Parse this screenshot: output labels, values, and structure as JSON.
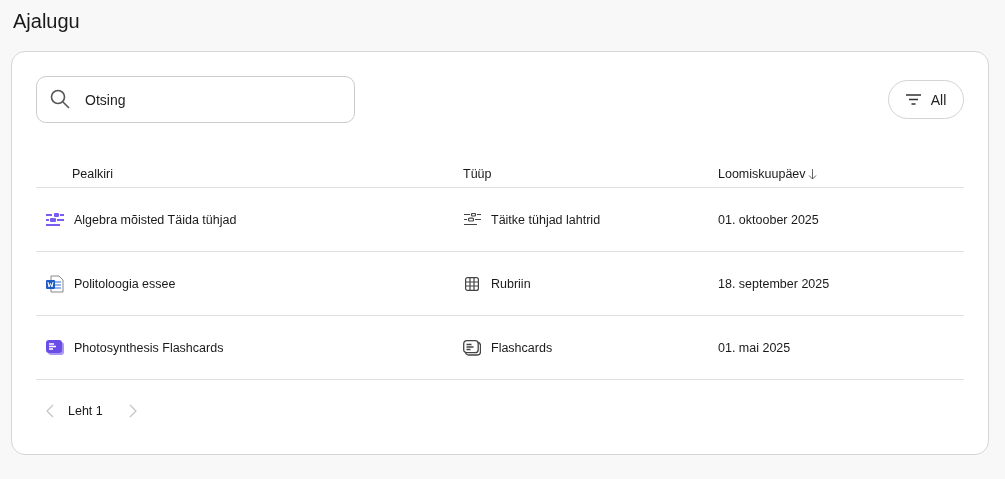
{
  "page": {
    "title": "Ajalugu"
  },
  "search": {
    "placeholder": "Otsing"
  },
  "filter": {
    "label": "All"
  },
  "table": {
    "columns": [
      {
        "label": "Pealkiri",
        "sorted": false
      },
      {
        "label": "Tüüp",
        "sorted": false
      },
      {
        "label": "Loomiskuupäev",
        "sorted": true
      }
    ],
    "rows": [
      {
        "kind": "fill_blanks",
        "title": "Algebra mõisted Täida tühjad",
        "type": "Täitke tühjad lahtrid",
        "date": "01. oktoober 2025"
      },
      {
        "kind": "essay",
        "title": "Politoloogia essee",
        "type": "Rubriin",
        "date": "18. september 2025"
      },
      {
        "kind": "flashcards",
        "title": "Photosynthesis Flashcards",
        "type": "Flashcards",
        "date": "01. mai 2025"
      }
    ]
  },
  "pagination": {
    "label": "Leht 1",
    "prev_disabled": true,
    "next_disabled": true
  }
}
